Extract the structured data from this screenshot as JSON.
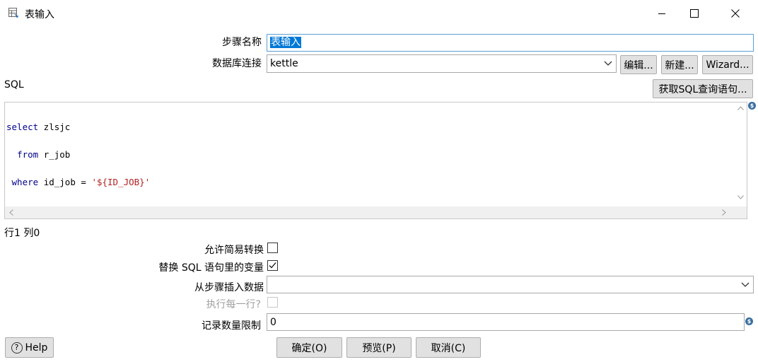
{
  "window": {
    "title": "表输入",
    "app_icon": "table-input-icon",
    "controls": [
      "minimize-icon",
      "maximize-icon",
      "close-icon"
    ]
  },
  "step_name": {
    "label": "步骤名称",
    "value": "表输入"
  },
  "connection": {
    "label": "数据库连接",
    "value": "kettle",
    "buttons": {
      "edit": "编辑...",
      "new": "新建...",
      "wizard": "Wizard..."
    }
  },
  "sql": {
    "label": "SQL",
    "get_sql_button": "获取SQL查询语句...",
    "lines": [
      {
        "kw": "select",
        "rest": " zlsjc"
      },
      {
        "indent": "  ",
        "kw": "from",
        "rest": " r_job"
      },
      {
        "indent": " ",
        "kw": "where",
        "rest": " id_job = ",
        "str": "'${ID_JOB}'"
      }
    ],
    "variable_icon": "dollar-variable-icon"
  },
  "cursor_position": "行1 列0",
  "options": {
    "lazy_conversion": {
      "label": "允许简易转换",
      "checked": false
    },
    "replace_variables": {
      "label": "替换 SQL 语句里的变量",
      "checked": true
    },
    "insert_from_step": {
      "label": "从步骤插入数据",
      "value": ""
    },
    "execute_each_row": {
      "label": "执行每一行?",
      "checked": false,
      "enabled": false
    },
    "limit": {
      "label": "记录数量限制",
      "value": "0"
    }
  },
  "footer": {
    "help": "Help",
    "ok": "确定(O)",
    "preview": "预览(P)",
    "cancel": "取消(C)"
  },
  "colors": {
    "accent": "#0078d7",
    "button_bg": "#e1e1e1",
    "variable_badge": "#3a6f9f"
  }
}
